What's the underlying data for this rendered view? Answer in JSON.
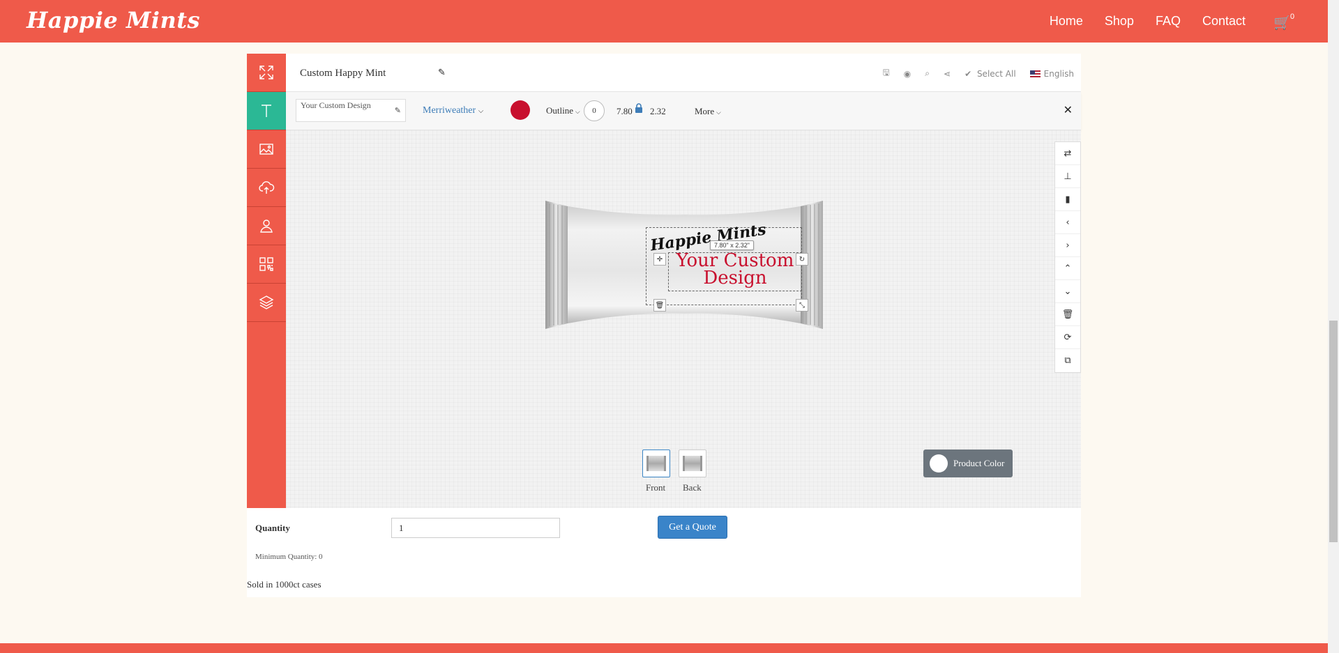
{
  "header": {
    "logo": "Happie Mints",
    "nav": [
      "Home",
      "Shop",
      "FAQ",
      "Contact"
    ],
    "cart_count": "0"
  },
  "designer": {
    "product_title": "Custom Happy Mint",
    "toolbar": {
      "select_all": "Select All",
      "language": "English"
    },
    "text_toolbar": {
      "text_value": "Your Custom Design",
      "font": "Merriweather",
      "font_color": "#c8102e",
      "outline_label": "Outline",
      "outline_width": "0",
      "width": "7.80",
      "height": "2.32",
      "more_label": "More"
    },
    "canvas": {
      "logo_text": "Happie Mints",
      "custom_text": "Your Custom Design",
      "dimension_tooltip": "7.80\" x 2.32\""
    },
    "views": {
      "front_label": "Front",
      "back_label": "Back",
      "product_color_label": "Product Color"
    }
  },
  "order": {
    "quantity_label": "Quantity",
    "quantity_value": "1",
    "quote_button": "Get a Quote",
    "min_quantity": "Minimum Quantity: 0",
    "sold_note": "Sold in 1000ct cases"
  },
  "colors": {
    "brand": "#ef5a4a",
    "accent": "#2bb895",
    "button": "#3a84c9"
  }
}
